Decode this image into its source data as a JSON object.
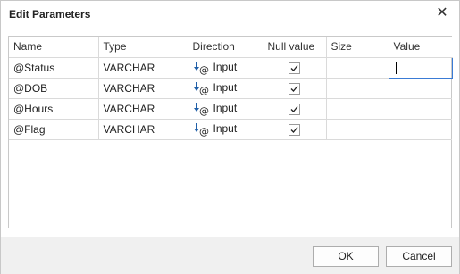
{
  "dialog": {
    "title": "Edit Parameters",
    "close_glyph": "✕",
    "columns": [
      "Name",
      "Type",
      "Direction",
      "Null value",
      "Size",
      "Value"
    ],
    "rows": [
      {
        "name": "@Status",
        "type": "VARCHAR",
        "direction": "Input",
        "null_value": true,
        "size": "",
        "value": ""
      },
      {
        "name": "@DOB",
        "type": "VARCHAR",
        "direction": "Input",
        "null_value": true,
        "size": "",
        "value": ""
      },
      {
        "name": "@Hours",
        "type": "VARCHAR",
        "direction": "Input",
        "null_value": true,
        "size": "",
        "value": ""
      },
      {
        "name": "@Flag",
        "type": "VARCHAR",
        "direction": "Input",
        "null_value": true,
        "size": "",
        "value": ""
      }
    ],
    "buttons": {
      "ok": "OK",
      "cancel": "Cancel"
    },
    "icons": {
      "direction": "input-direction-icon",
      "check": "checkmark-icon",
      "close": "close-icon"
    },
    "colors": {
      "arrow": "#1f5fa8",
      "active_cell_border": "#3a7bd5"
    }
  }
}
